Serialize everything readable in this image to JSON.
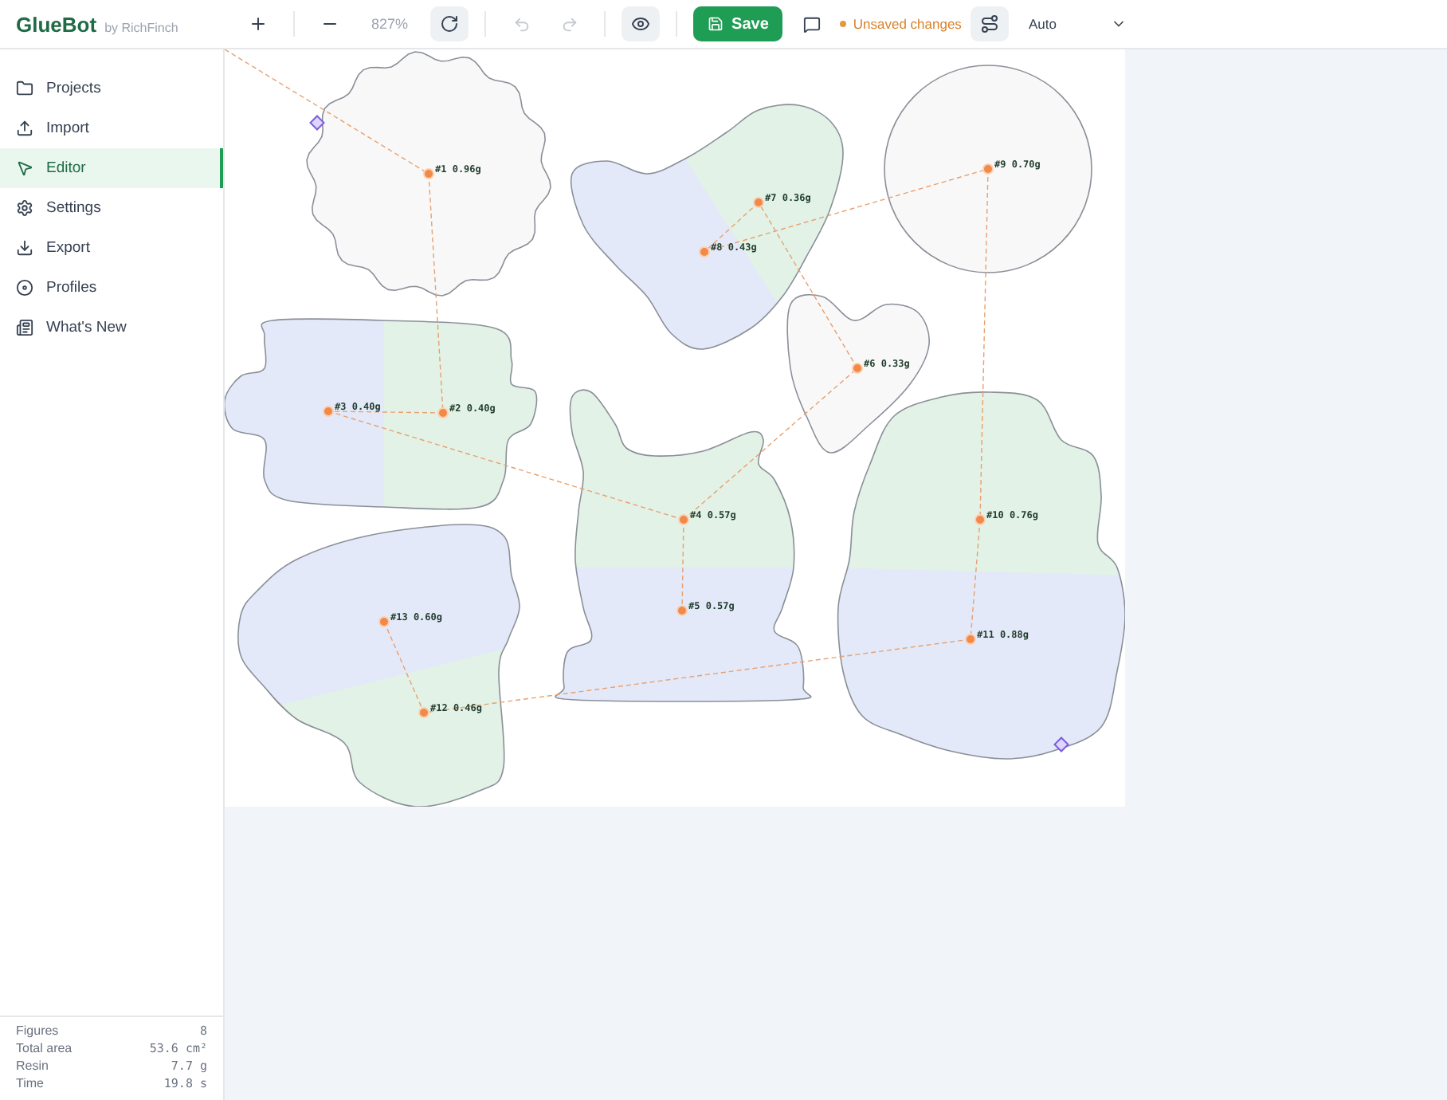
{
  "app": {
    "name": "GlueBot",
    "byline": "by RichFinch"
  },
  "toolbar": {
    "zoom": "827%",
    "save": "Save",
    "preview_on": true,
    "undo_disabled": true,
    "redo_disabled": true,
    "status": "Unsaved changes",
    "mode": "Auto"
  },
  "sidebar": {
    "items": [
      {
        "label": "Projects",
        "selected": false
      },
      {
        "label": "Import",
        "selected": false
      },
      {
        "label": "Editor",
        "selected": true
      },
      {
        "label": "Settings",
        "selected": false
      },
      {
        "label": "Export",
        "selected": false
      },
      {
        "label": "Profiles",
        "selected": false
      },
      {
        "label": "What's New",
        "selected": false
      }
    ]
  },
  "stats": [
    {
      "label": "Figures",
      "value": "8"
    },
    {
      "label": "Total area",
      "value": "53.6 cm²"
    },
    {
      "label": "Resin",
      "value": "7.7 g"
    },
    {
      "label": "Time",
      "value": "19.8 s"
    }
  ],
  "pins": [
    {
      "label": "#1 0.96g"
    },
    {
      "label": "#7 0.36g"
    },
    {
      "label": "#8 0.43g"
    },
    {
      "label": "#9 0.70g"
    },
    {
      "label": "#6 0.33g"
    },
    {
      "label": "#3 0.40g"
    },
    {
      "label": "#2 0.40g"
    },
    {
      "label": "#4 0.57g"
    },
    {
      "label": "#5 0.57g"
    },
    {
      "label": "#10 0.76g"
    },
    {
      "label": "#11 0.88g"
    },
    {
      "label": "#13 0.60g"
    },
    {
      "label": "#12 0.46g"
    }
  ]
}
